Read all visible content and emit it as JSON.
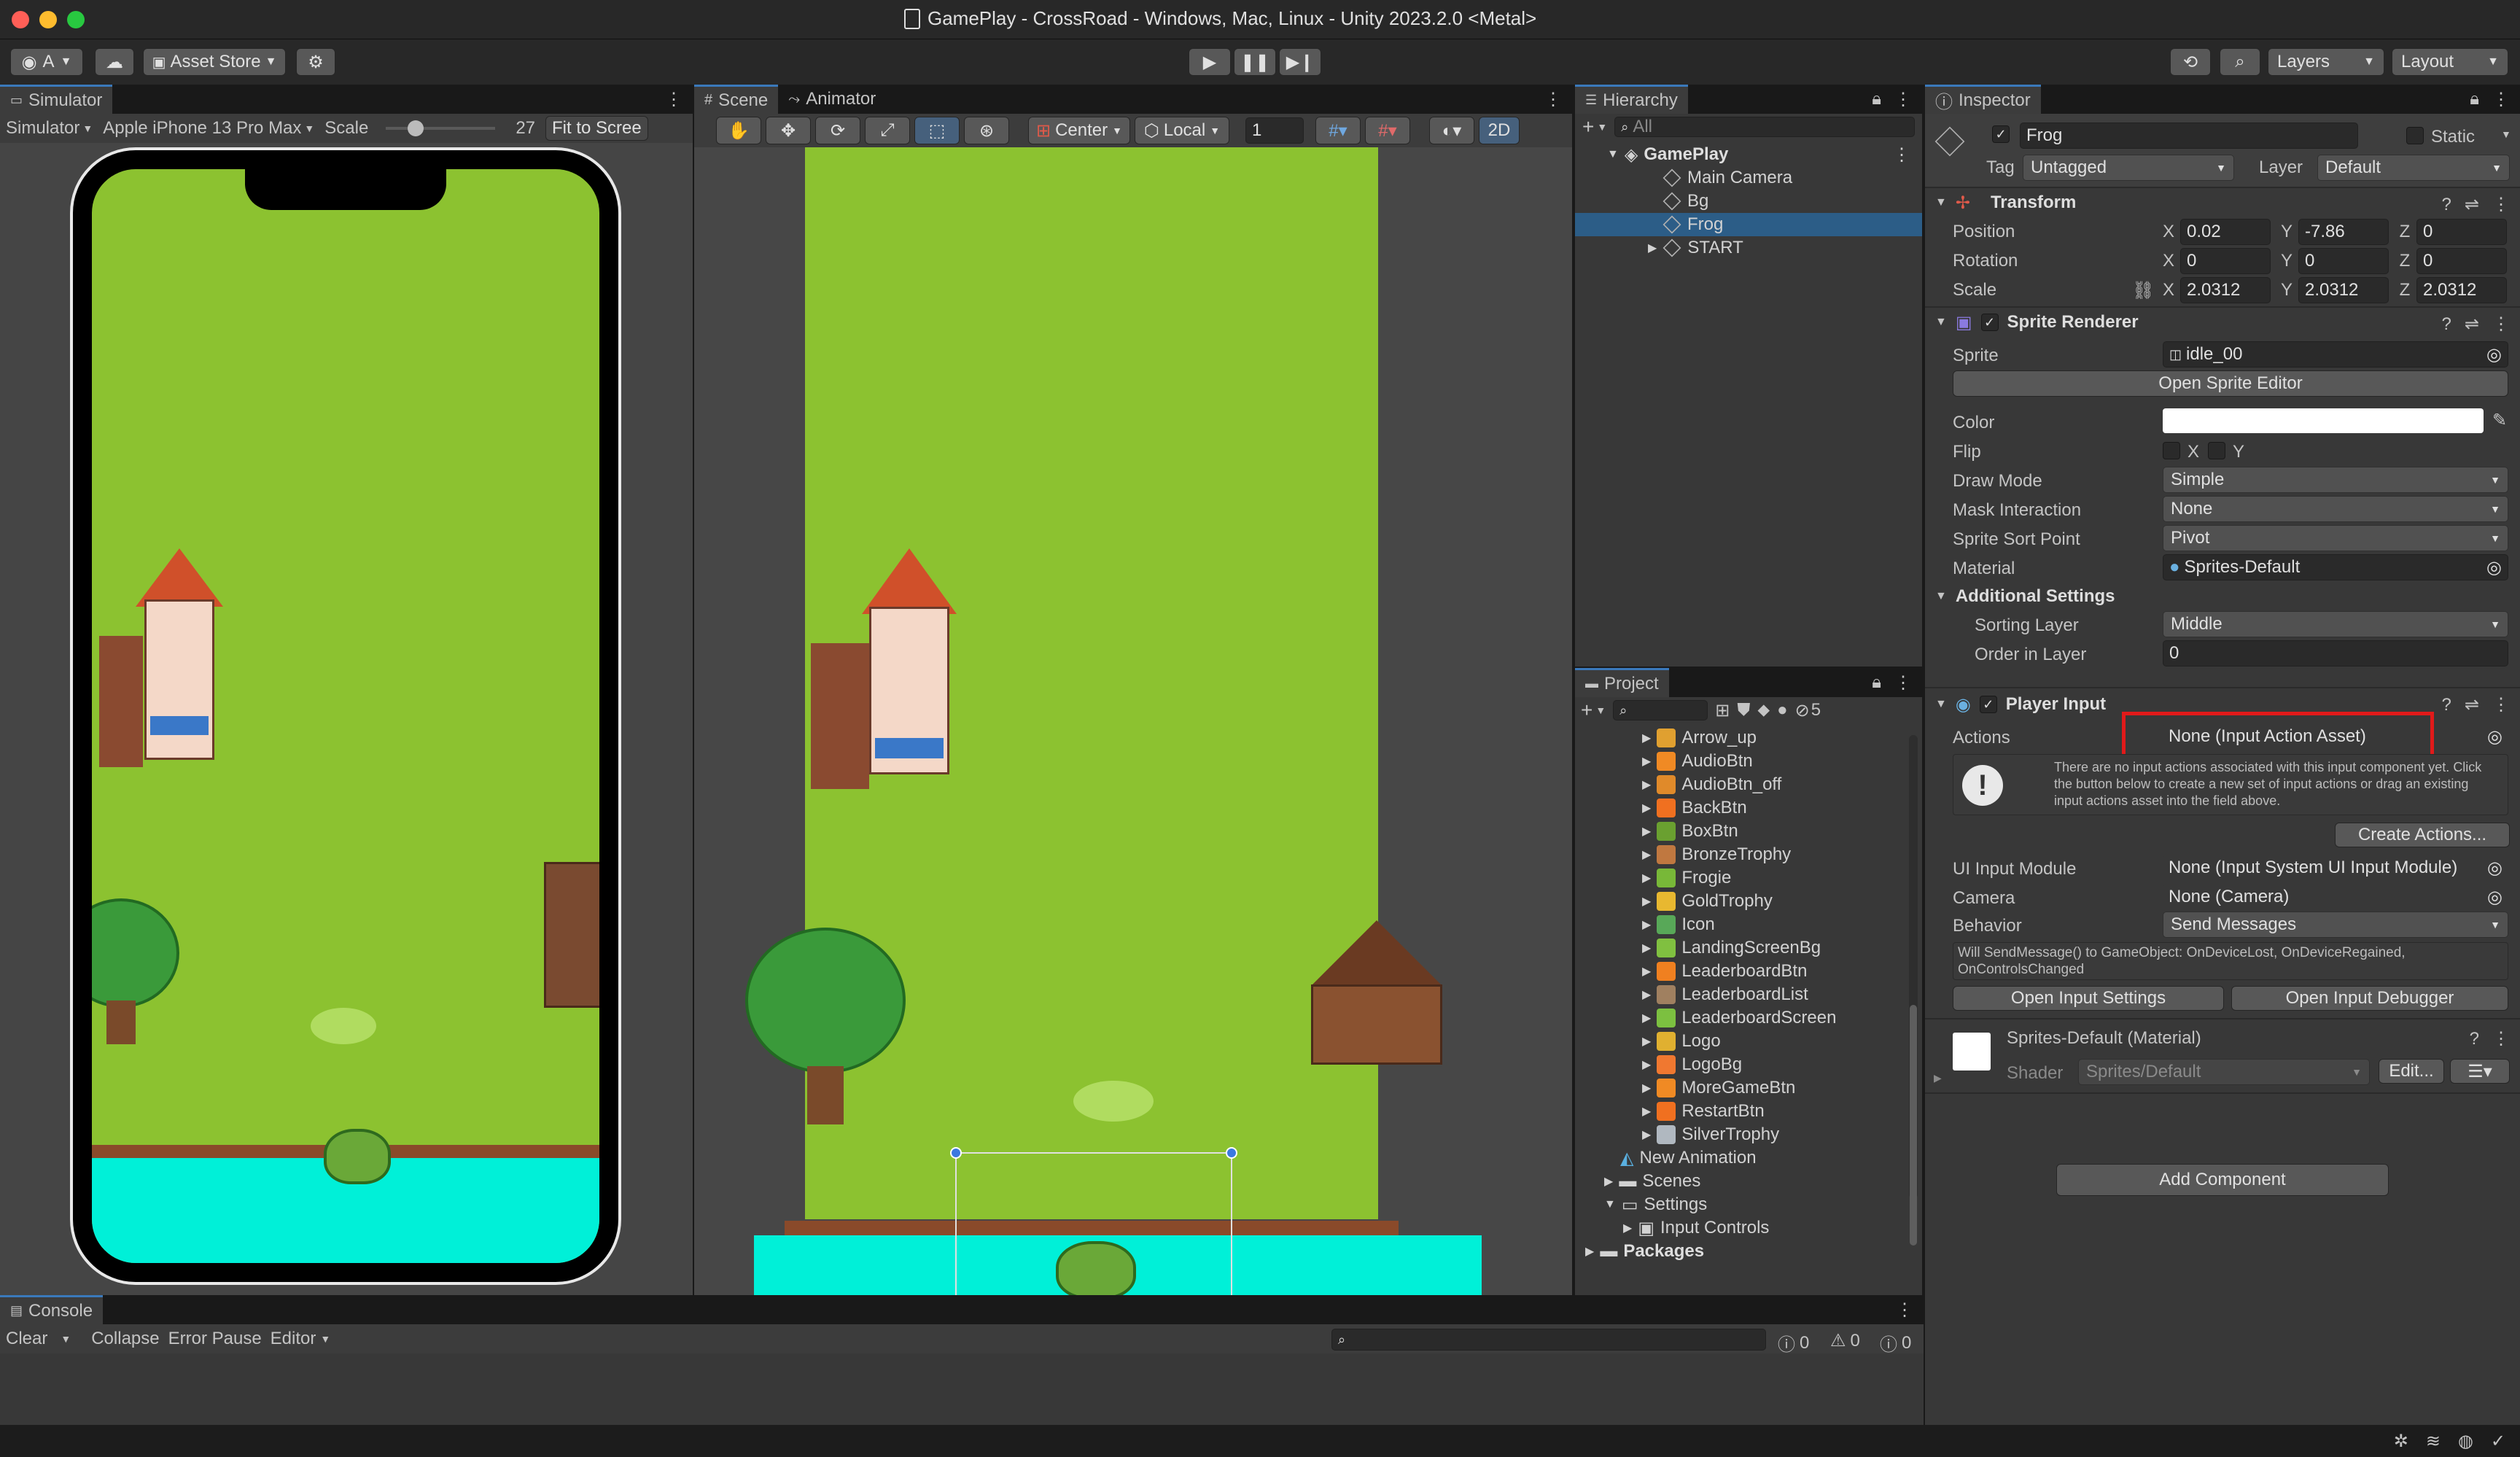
{
  "window": {
    "title": "GamePlay - CrossRoad - Windows, Mac, Linux - Unity 2023.2.0 <Metal>"
  },
  "toolbar": {
    "account": "A",
    "asset_store": "Asset Store",
    "layers": "Layers",
    "layout": "Layout"
  },
  "simulator": {
    "tab": "Simulator",
    "mode": "Simulator",
    "device": "Apple iPhone 13 Pro Max",
    "scale_label": "Scale",
    "scale_value": "27",
    "fit": "Fit to Scree"
  },
  "scene": {
    "tab_scene": "Scene",
    "tab_animator": "Animator",
    "pivot": "Center",
    "space": "Local",
    "snap": "1",
    "mode2d": "2D"
  },
  "hierarchy": {
    "tab": "Hierarchy",
    "search": "All",
    "root": "GamePlay",
    "items": [
      {
        "label": "Main Camera"
      },
      {
        "label": "Bg"
      },
      {
        "label": "Frog"
      },
      {
        "label": "START"
      }
    ]
  },
  "project": {
    "tab": "Project",
    "hidden_count": "5",
    "assets": [
      {
        "label": "Arrow_up",
        "color": "#e0a030"
      },
      {
        "label": "AudioBtn",
        "color": "#f08a24"
      },
      {
        "label": "AudioBtn_off",
        "color": "#e08a2a"
      },
      {
        "label": "BackBtn",
        "color": "#f07020"
      },
      {
        "label": "BoxBtn",
        "color": "#6aa030"
      },
      {
        "label": "BronzeTrophy",
        "color": "#c07840"
      },
      {
        "label": "Frogie",
        "color": "#78b838"
      },
      {
        "label": "GoldTrophy",
        "color": "#e8b830"
      },
      {
        "label": "Icon",
        "color": "#58a858"
      },
      {
        "label": "LandingScreenBg",
        "color": "#80c040"
      },
      {
        "label": "LeaderboardBtn",
        "color": "#f08020"
      },
      {
        "label": "LeaderboardList",
        "color": "#a08060"
      },
      {
        "label": "LeaderboardScreen",
        "color": "#7cc040"
      },
      {
        "label": "Logo",
        "color": "#e0b030"
      },
      {
        "label": "LogoBg",
        "color": "#f07830"
      },
      {
        "label": "MoreGameBtn",
        "color": "#f08a24"
      },
      {
        "label": "RestartBtn",
        "color": "#f07020"
      },
      {
        "label": "SilverTrophy",
        "color": "#b0b8c0"
      }
    ],
    "folders": {
      "new_animation": "New Animation",
      "scenes": "Scenes",
      "settings": "Settings",
      "input_controls": "Input Controls",
      "packages": "Packages"
    }
  },
  "inspector": {
    "tab": "Inspector",
    "object_name": "Frog",
    "static_label": "Static",
    "tag_label": "Tag",
    "tag_value": "Untagged",
    "layer_label": "Layer",
    "layer_value": "Default",
    "transform": {
      "title": "Transform",
      "position_label": "Position",
      "rotation_label": "Rotation",
      "scale_label": "Scale",
      "pos": {
        "x": "0.02",
        "y": "-7.86",
        "z": "0"
      },
      "rot": {
        "x": "0",
        "y": "0",
        "z": "0"
      },
      "scale": {
        "x": "2.0312",
        "y": "2.0312",
        "z": "2.0312"
      }
    },
    "sprite_renderer": {
      "title": "Sprite Renderer",
      "sprite_label": "Sprite",
      "sprite_value": "idle_00",
      "open_editor": "Open Sprite Editor",
      "color_label": "Color",
      "flip_label": "Flip",
      "flip_x": "X",
      "flip_y": "Y",
      "draw_mode_label": "Draw Mode",
      "draw_mode": "Simple",
      "mask_label": "Mask Interaction",
      "mask": "None",
      "sort_point_label": "Sprite Sort Point",
      "sort_point": "Pivot",
      "material_label": "Material",
      "material": "Sprites-Default",
      "additional": "Additional Settings",
      "sorting_layer_label": "Sorting Layer",
      "sorting_layer": "Middle",
      "order_label": "Order in Layer",
      "order": "0"
    },
    "player_input": {
      "title": "Player Input",
      "actions_label": "Actions",
      "actions_value": "None (Input Action Asset)",
      "info": "There are no input actions associated with this input component yet. Click the button below to create a new set of input actions or drag an existing input actions asset into the field above.",
      "create_actions": "Create Actions...",
      "ui_module_label": "UI Input Module",
      "ui_module": "None (Input System UI Input Module)",
      "camera_label": "Camera",
      "camera": "None (Camera)",
      "behavior_label": "Behavior",
      "behavior": "Send Messages",
      "behavior_note": "Will SendMessage() to GameObject: OnDeviceLost, OnDeviceRegained, OnControlsChanged",
      "open_settings": "Open Input Settings",
      "open_debugger": "Open Input Debugger"
    },
    "material": {
      "title": "Sprites-Default (Material)",
      "shader_label": "Shader",
      "shader": "Sprites/Default",
      "edit": "Edit..."
    },
    "add_component": "Add Component"
  },
  "console": {
    "tab": "Console",
    "clear": "Clear",
    "collapse": "Collapse",
    "error_pause": "Error Pause",
    "editor": "Editor",
    "count_info": "0",
    "count_warn": "0",
    "count_err": "0"
  },
  "colors": {
    "grass": "#8cc230",
    "water": "#00f0d8",
    "highlight": "#e11a1a",
    "selection": "#2c5d87"
  }
}
